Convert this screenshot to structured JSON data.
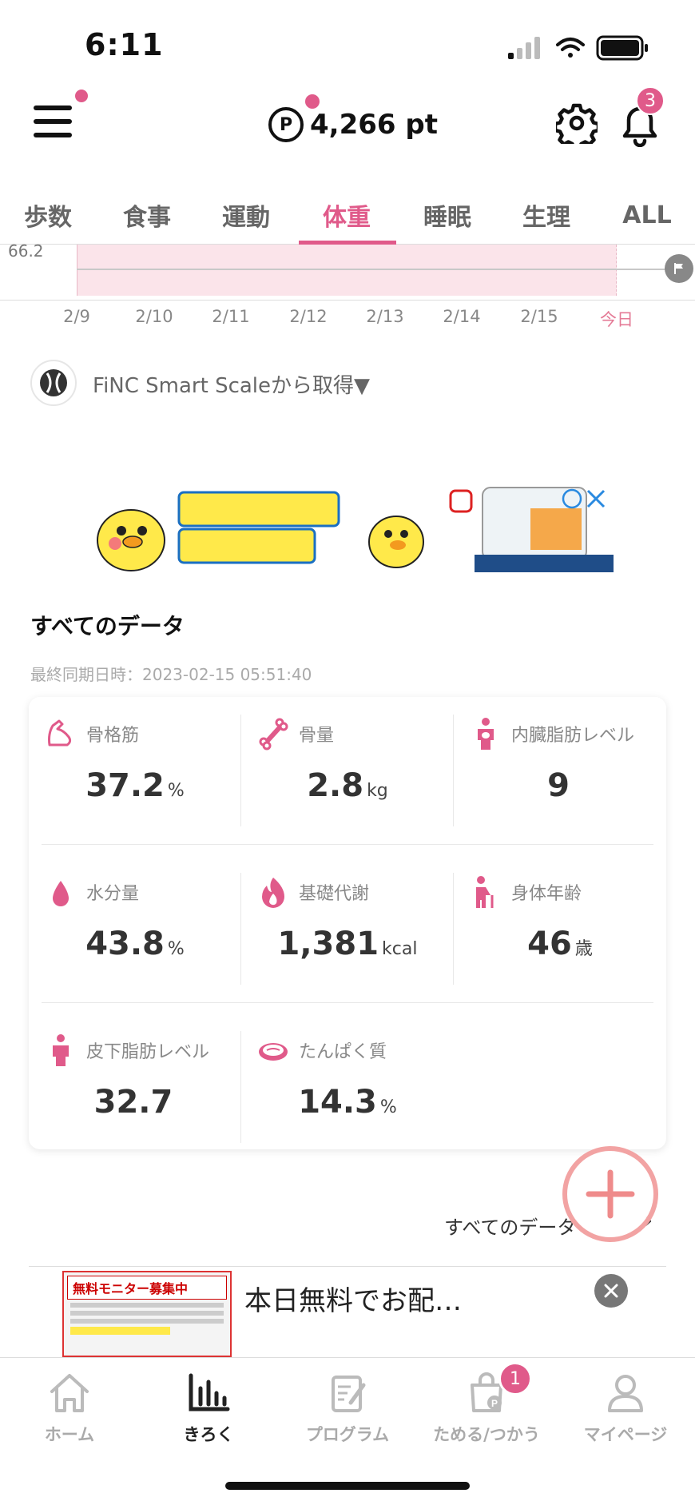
{
  "status": {
    "time": "6:11"
  },
  "header": {
    "points": "4,266 pt",
    "points_icon": "P",
    "notification_count": "3"
  },
  "tabs": [
    {
      "label": "歩数"
    },
    {
      "label": "食事"
    },
    {
      "label": "運動"
    },
    {
      "label": "体重",
      "active": true
    },
    {
      "label": "睡眠"
    },
    {
      "label": "生理"
    },
    {
      "label": "ALL"
    }
  ],
  "chart": {
    "y_label": "66.2",
    "dates": [
      "2/9",
      "2/10",
      "2/11",
      "2/12",
      "2/13",
      "2/14",
      "2/15",
      "今日"
    ]
  },
  "source": {
    "text": "FiNC Smart Scaleから取得▼"
  },
  "section": {
    "title": "すべてのデータ",
    "sync": "最終同期日時：2023-02-15 05:51:40"
  },
  "metrics": [
    {
      "label": "骨格筋",
      "value": "37.2",
      "unit": "%",
      "icon": "muscle-icon"
    },
    {
      "label": "骨量",
      "value": "2.8",
      "unit": "kg",
      "icon": "bone-icon"
    },
    {
      "label": "内臓脂肪レベル",
      "value": "9",
      "unit": "",
      "icon": "visceral-fat-icon"
    },
    {
      "label": "水分量",
      "value": "43.8",
      "unit": "%",
      "icon": "water-drop-icon"
    },
    {
      "label": "基礎代謝",
      "value": "1,381",
      "unit": "kcal",
      "icon": "flame-icon"
    },
    {
      "label": "身体年齢",
      "value": "46",
      "unit": "歳",
      "icon": "elderly-icon"
    },
    {
      "label": "皮下脂肪レベル",
      "value": "32.7",
      "unit": "",
      "icon": "body-icon"
    },
    {
      "label": "たんぱく質",
      "value": "14.3",
      "unit": "%",
      "icon": "meat-icon"
    }
  ],
  "all_data_link": "すべてのデータ",
  "bottom_ad": {
    "text": "本日無料でお配…",
    "image_title": "無料モニター募集中"
  },
  "nav": [
    {
      "label": "ホーム",
      "icon": "home-icon"
    },
    {
      "label": "きろく",
      "icon": "chart-icon",
      "active": true
    },
    {
      "label": "プログラム",
      "icon": "program-icon"
    },
    {
      "label": "ためる/つかう",
      "icon": "shopping-bag-icon"
    },
    {
      "label": "マイページ",
      "icon": "profile-icon"
    }
  ],
  "nav_badge": "1",
  "colors": {
    "accent": "#e05a8a",
    "fab": "#f2a3a3",
    "band": "#fbe4ea"
  }
}
